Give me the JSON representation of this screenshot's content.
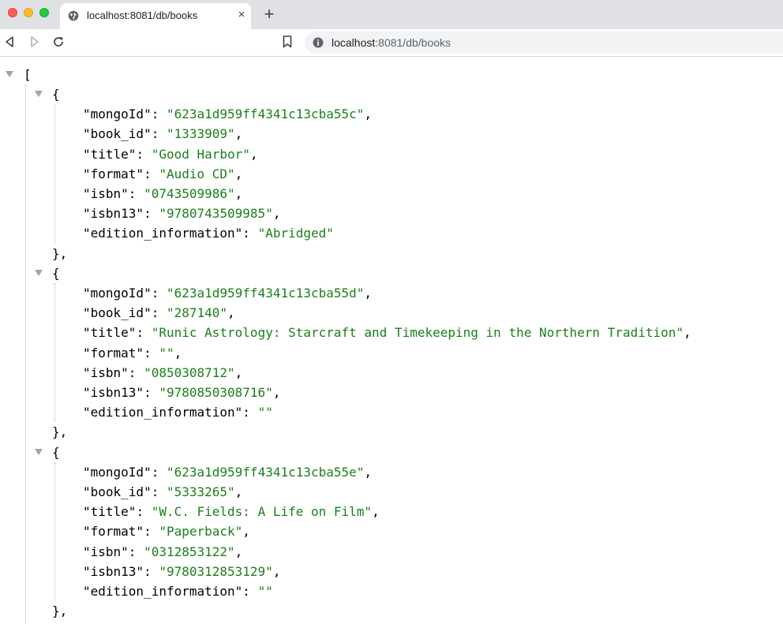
{
  "browser": {
    "tab_title": "localhost:8081/db/books",
    "tab_close_glyph": "×",
    "new_tab_glyph": "+",
    "url_host": "localhost",
    "url_path": ":8081/db/books",
    "icons": [
      "globe-icon",
      "back-icon",
      "forward-icon",
      "reload-icon",
      "bookmark-icon",
      "info-icon"
    ]
  },
  "json": {
    "open_bracket": "[",
    "open_brace": "{",
    "close_brace": "},",
    "records": [
      {
        "mongoId": "623a1d959ff4341c13cba55c",
        "book_id": "1333909",
        "title": "Good Harbor",
        "format": "Audio CD",
        "isbn": "0743509986",
        "isbn13": "9780743509985",
        "edition_information": "Abridged"
      },
      {
        "mongoId": "623a1d959ff4341c13cba55d",
        "book_id": "287140",
        "title": "Runic Astrology: Starcraft and Timekeeping in the Northern Tradition",
        "format": "",
        "isbn": "0850308712",
        "isbn13": "9780850308716",
        "edition_information": ""
      },
      {
        "mongoId": "623a1d959ff4341c13cba55e",
        "book_id": "5333265",
        "title": "W.C. Fields: A Life on Film",
        "format": "Paperback",
        "isbn": "0312853122",
        "isbn13": "9780312853129",
        "edition_information": ""
      }
    ]
  },
  "colors": {
    "string": "#1a7f1a",
    "key": "#000000",
    "toggle": "#a4a4a4",
    "tabbar": "#dfe1e5",
    "omnibox": "#f1f3f4"
  }
}
